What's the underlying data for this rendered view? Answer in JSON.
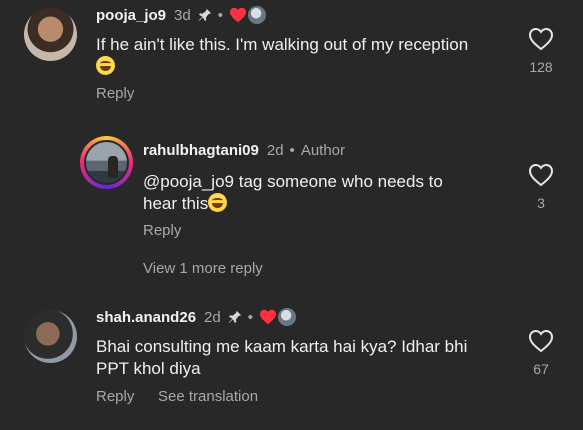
{
  "comments": [
    {
      "username": "pooja_jo9",
      "time": "3d",
      "text": "If he ain't like this. I'm walking out of my reception",
      "likes": "128",
      "reply_label": "Reply"
    },
    {
      "username": "rahulbhagtani09",
      "time": "2d",
      "author_label": "Author",
      "text_line1": "@pooja_jo9  tag someone who needs to",
      "text_line2": "hear this",
      "likes": "3",
      "reply_label": "Reply",
      "view_more": "View 1 more reply"
    },
    {
      "username": "shah.anand26",
      "time": "2d",
      "text_line1": "Bhai consulting me kaam karta hai kya? Idhar bhi",
      "text_line2": "PPT khol diya",
      "likes": "67",
      "reply_label": "Reply",
      "see_translation": "See translation"
    }
  ],
  "colors": {
    "background": "#282828",
    "liked_heart": "#ff3040",
    "secondary_text": "#a8a8a8"
  },
  "icons": [
    "pin-icon",
    "heart-icon",
    "creator-avatar-icon",
    "laughing-emoji"
  ]
}
